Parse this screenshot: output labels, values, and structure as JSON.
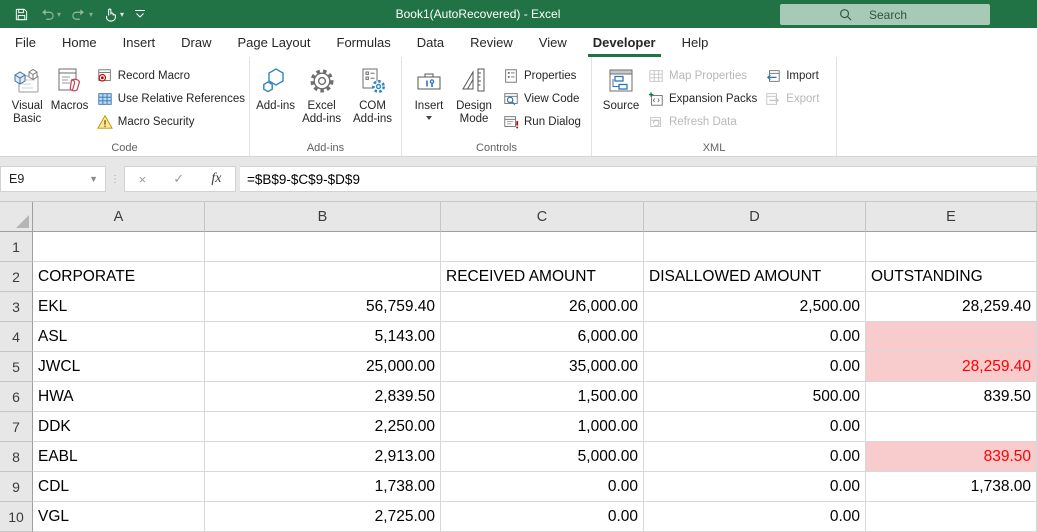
{
  "titlebar": {
    "title": "Book1(AutoRecovered) - Excel",
    "search_placeholder": "Search",
    "icons": {
      "qat": [
        "save-icon",
        "undo-icon",
        "redo-icon",
        "touch-mode-icon",
        "customize-qat-icon"
      ]
    }
  },
  "tabs": {
    "items": [
      {
        "label": "File"
      },
      {
        "label": "Home"
      },
      {
        "label": "Insert"
      },
      {
        "label": "Draw"
      },
      {
        "label": "Page Layout"
      },
      {
        "label": "Formulas"
      },
      {
        "label": "Data"
      },
      {
        "label": "Review"
      },
      {
        "label": "View"
      },
      {
        "label": "Developer",
        "active": true
      },
      {
        "label": "Help"
      }
    ]
  },
  "ribbon": {
    "code": {
      "visual_basic": "Visual Basic",
      "macros": "Macros",
      "record_macro": "Record Macro",
      "use_relative_references": "Use Relative References",
      "macro_security": "Macro Security",
      "label": "Code"
    },
    "addins": {
      "add_ins": "Add-ins",
      "excel_add_ins": "Excel Add-ins",
      "com_add_ins": "COM Add-ins",
      "label": "Add-ins"
    },
    "controls": {
      "insert": "Insert",
      "design_mode": "Design Mode",
      "properties": "Properties",
      "view_code": "View Code",
      "run_dialog": "Run Dialog",
      "label": "Controls"
    },
    "xml": {
      "source": "Source",
      "map_properties": "Map Properties",
      "expansion_packs": "Expansion Packs",
      "refresh_data": "Refresh Data",
      "import": "Import",
      "export": "Export",
      "label": "XML"
    }
  },
  "formula_bar": {
    "name_box": "E9",
    "cancel": "×",
    "enter": "✓",
    "fx": "fx",
    "formula": "=$B$9-$C$9-$D$9"
  },
  "sheet": {
    "col_headers": [
      "A",
      "B",
      "C",
      "D",
      "E"
    ],
    "rows": [
      {
        "n": "1",
        "a": "",
        "b": "",
        "c": "",
        "d": "",
        "e": ""
      },
      {
        "n": "2",
        "a": "CORPORATE",
        "b": "",
        "c": "RECEIVED AMOUNT",
        "d": "DISALLOWED AMOUNT",
        "e": "OUTSTANDING"
      },
      {
        "n": "3",
        "a": "EKL",
        "b": "56,759.40",
        "c": "26,000.00",
        "d": "2,500.00",
        "e": "28,259.40"
      },
      {
        "n": "4",
        "a": "ASL",
        "b": "5,143.00",
        "c": "6,000.00",
        "d": "0.00",
        "e": ""
      },
      {
        "n": "5",
        "a": "JWCL",
        "b": "25,000.00",
        "c": "35,000.00",
        "d": "0.00",
        "e": "28,259.40"
      },
      {
        "n": "6",
        "a": "HWA",
        "b": "2,839.50",
        "c": "1,500.00",
        "d": "500.00",
        "e": "839.50"
      },
      {
        "n": "7",
        "a": "DDK",
        "b": "2,250.00",
        "c": "1,000.00",
        "d": "0.00",
        "e": ""
      },
      {
        "n": "8",
        "a": "EABL",
        "b": "2,913.00",
        "c": "5,000.00",
        "d": "0.00",
        "e": "839.50"
      },
      {
        "n": "9",
        "a": "CDL",
        "b": "1,738.00",
        "c": "0.00",
        "d": "0.00",
        "e": "1,738.00"
      },
      {
        "n": "10",
        "a": "VGL",
        "b": "2,725.00",
        "c": "0.00",
        "d": "0.00",
        "e": ""
      }
    ],
    "highlight_fill": "#F8CBCC",
    "highlight_text": "#FF0000"
  },
  "colors": {
    "excel_green": "#217346",
    "search_bg": "#A6CAB6"
  }
}
